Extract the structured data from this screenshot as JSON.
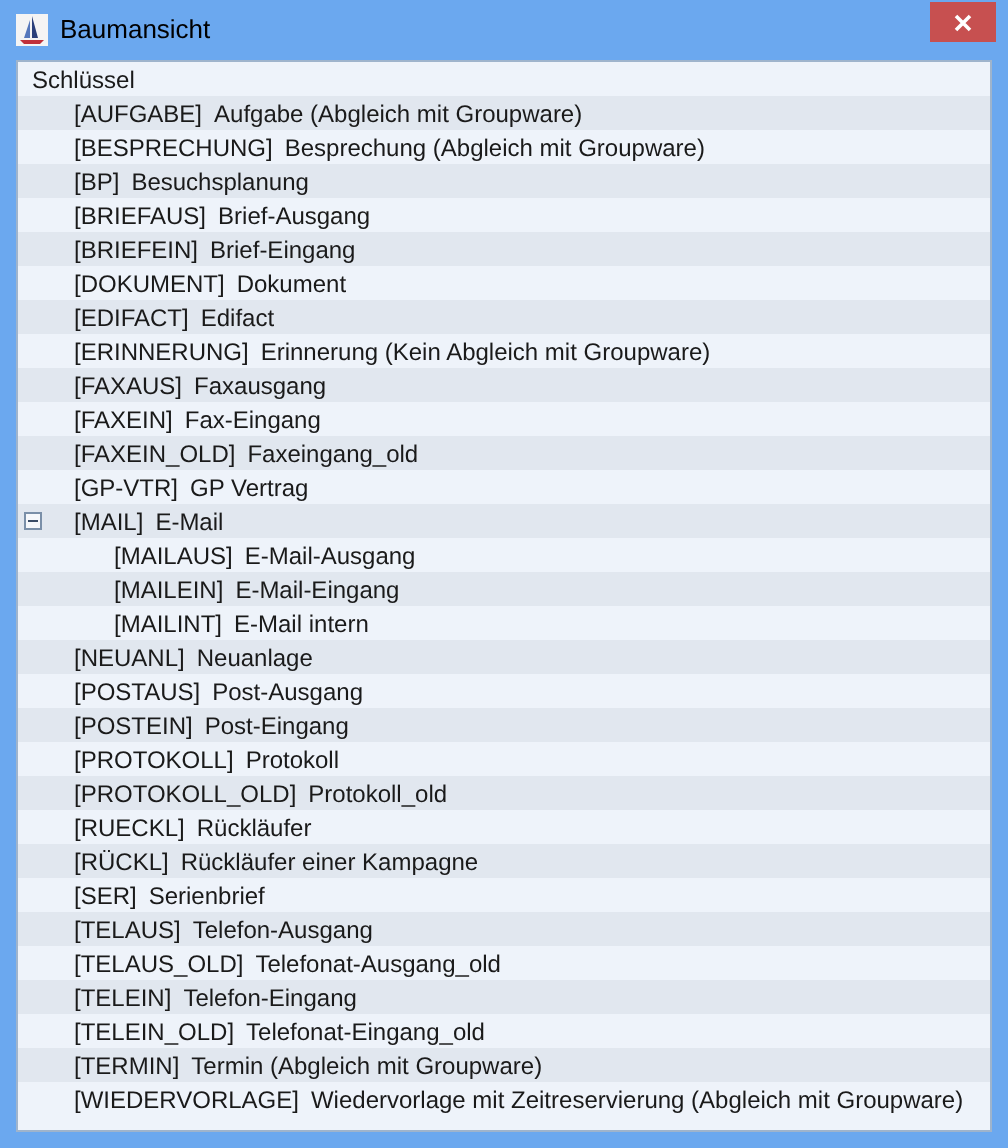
{
  "window": {
    "title": "Baumansicht"
  },
  "tree": {
    "label": "Schlüssel",
    "children": [
      {
        "key": "[AUFGABE]",
        "label": "Aufgabe (Abgleich mit Groupware)"
      },
      {
        "key": "[BESPRECHUNG]",
        "label": "Besprechung (Abgleich mit Groupware)"
      },
      {
        "key": "[BP]",
        "label": "Besuchsplanung"
      },
      {
        "key": "[BRIEFAUS]",
        "label": "Brief-Ausgang"
      },
      {
        "key": "[BRIEFEIN]",
        "label": "Brief-Eingang"
      },
      {
        "key": "[DOKUMENT]",
        "label": "Dokument"
      },
      {
        "key": "[EDIFACT]",
        "label": "Edifact"
      },
      {
        "key": "[ERINNERUNG]",
        "label": "Erinnerung (Kein Abgleich mit Groupware)"
      },
      {
        "key": "[FAXAUS]",
        "label": "Faxausgang"
      },
      {
        "key": "[FAXEIN]",
        "label": "Fax-Eingang"
      },
      {
        "key": "[FAXEIN_OLD]",
        "label": "Faxeingang_old"
      },
      {
        "key": "[GP-VTR]",
        "label": "GP Vertrag"
      },
      {
        "key": "[MAIL]",
        "label": "E-Mail",
        "expanded": true,
        "children": [
          {
            "key": "[MAILAUS]",
            "label": "E-Mail-Ausgang"
          },
          {
            "key": "[MAILEIN]",
            "label": "E-Mail-Eingang"
          },
          {
            "key": "[MAILINT]",
            "label": "E-Mail intern"
          }
        ]
      },
      {
        "key": "[NEUANL]",
        "label": "Neuanlage"
      },
      {
        "key": "[POSTAUS]",
        "label": "Post-Ausgang"
      },
      {
        "key": "[POSTEIN]",
        "label": "Post-Eingang"
      },
      {
        "key": "[PROTOKOLL]",
        "label": "Protokoll"
      },
      {
        "key": "[PROTOKOLL_OLD]",
        "label": "Protokoll_old"
      },
      {
        "key": "[RUECKL]",
        "label": "Rückläufer"
      },
      {
        "key": "[RÜCKL]",
        "label": "Rückläufer einer Kampagne"
      },
      {
        "key": "[SER]",
        "label": "Serienbrief"
      },
      {
        "key": "[TELAUS]",
        "label": "Telefon-Ausgang"
      },
      {
        "key": "[TELAUS_OLD]",
        "label": "Telefonat-Ausgang_old"
      },
      {
        "key": "[TELEIN]",
        "label": "Telefon-Eingang"
      },
      {
        "key": "[TELEIN_OLD]",
        "label": "Telefonat-Eingang_old"
      },
      {
        "key": "[TERMIN]",
        "label": "Termin (Abgleich mit Groupware)"
      },
      {
        "key": "[WIEDERVORLAGE]",
        "label": "Wiedervorlage mit Zeitreservierung (Abgleich mit Groupware)"
      }
    ]
  }
}
